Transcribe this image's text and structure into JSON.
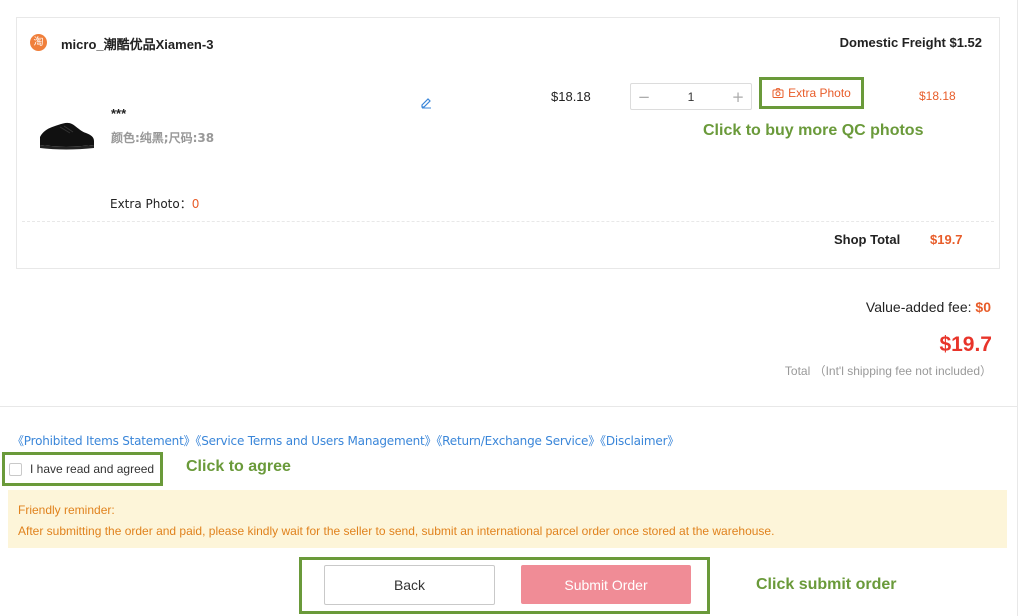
{
  "shop": {
    "icon_glyph": "淘",
    "name": "micro_潮酷优品Xiamen-3",
    "freight": "Domestic Freight $1.52"
  },
  "item": {
    "title": "***",
    "spec": "颜色:纯黑;尺码:38",
    "unit_price": "$18.18",
    "quantity": "1",
    "minus": "−",
    "plus": "+",
    "extra_photo_button": "Extra Photo",
    "line_price": "$18.18",
    "extra_photo_label": "Extra Photo：",
    "extra_photo_count": "0"
  },
  "annotations": {
    "qc_hint": "Click to buy more QC photos",
    "agree_hint": "Click to agree",
    "submit_hint": "Click submit  order",
    "color": "#6a9a3a"
  },
  "shop_total": {
    "label": "Shop Total",
    "value": "$19.7"
  },
  "summary": {
    "vat_label": "Value-added fee: ",
    "vat_value": "$0",
    "grand_total": "$19.7",
    "total_note": "Total （Int'l shipping fee not included）"
  },
  "links": [
    "《Prohibited Items Statement》",
    "《Service Terms and Users Management》",
    "《Return/Exchange Service》",
    "《Disclaimer》"
  ],
  "agreement": {
    "label": "I have read and agreed",
    "checked": false
  },
  "reminder": {
    "title": "Friendly reminder:",
    "body": "After submitting the order and paid, please kindly wait for the seller to send, submit an international parcel order once stored at the warehouse."
  },
  "buttons": {
    "back": "Back",
    "submit": "Submit Order"
  },
  "colors": {
    "accent_orange": "#e85d2a",
    "price_red": "#e8342a",
    "link_blue": "#3a86d9",
    "submit_pink": "#f08c96",
    "reminder_bg": "#fdf5d9"
  }
}
